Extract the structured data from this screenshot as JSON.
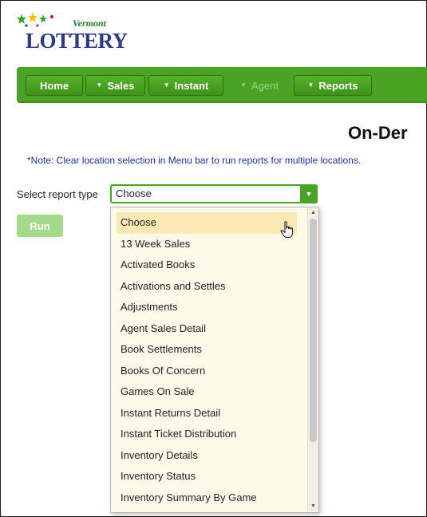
{
  "logo": {
    "script_text": "Vermont",
    "wordmark": "LOTTERY",
    "colors": {
      "star_yellow": "#f5c400",
      "star_green": "#2fa52f",
      "star_blue": "#2b3a86",
      "star_red": "#d81f2a"
    }
  },
  "nav": {
    "items": [
      {
        "label": "Home",
        "dropdown": false,
        "enabled": true
      },
      {
        "label": "Sales",
        "dropdown": true,
        "enabled": true
      },
      {
        "label": "Instant",
        "dropdown": true,
        "enabled": true
      },
      {
        "label": "Agent",
        "dropdown": true,
        "enabled": false
      },
      {
        "label": "Reports",
        "dropdown": true,
        "enabled": true
      }
    ],
    "colors": {
      "bar": "#4aa325",
      "disabled_text": "#9bd07e"
    }
  },
  "page": {
    "title": "On-Der",
    "note": "*Note: Clear location selection in Menu bar to run reports for multiple locations."
  },
  "report_select": {
    "label": "Select report type",
    "value": "Choose",
    "open": true,
    "highlighted": "Choose",
    "options": [
      "Choose",
      "13 Week Sales",
      "Activated Books",
      "Activations and Settles",
      "Adjustments",
      "Agent Sales Detail",
      "Book Settlements",
      "Books Of Concern",
      "Games On Sale",
      "Instant Returns Detail",
      "Instant Ticket Distribution",
      "Inventory Details",
      "Inventory Status",
      "Inventory Summary By Game"
    ]
  },
  "run_button": {
    "label": "Run",
    "enabled": false
  },
  "icons": {
    "dropdown_arrow": "triangle-down-icon",
    "cursor": "hand-pointer-icon"
  }
}
